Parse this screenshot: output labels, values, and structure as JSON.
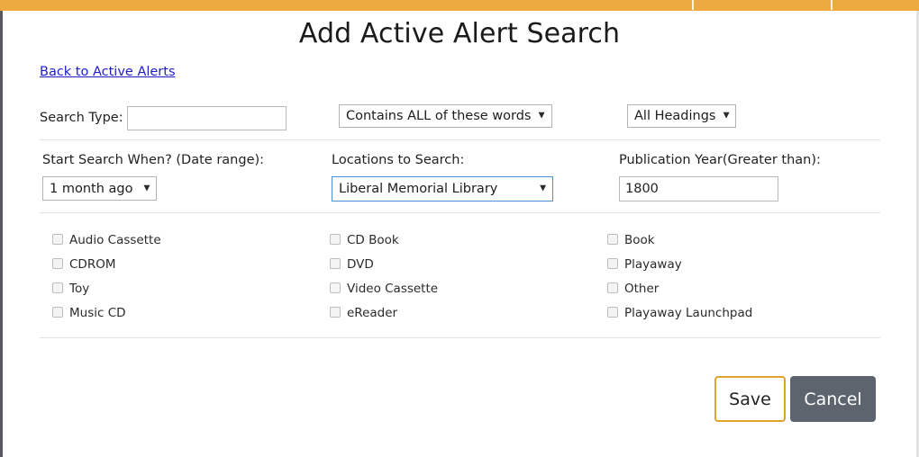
{
  "app": {
    "accent_color": "#eca93e",
    "link_color": "#2020c8",
    "save_border_color": "#e0a42c",
    "cancel_bg_color": "#5d646e"
  },
  "header": {
    "title": "Add Active Alert Search",
    "back_link": "Back to Active Alerts"
  },
  "search_row": {
    "search_type_label": "Search Type:",
    "search_type_value": "",
    "search_type_placeholder": "",
    "match_mode_value": "Contains ALL of these words",
    "headings_value": "All Headings",
    "caret_icon": "▼"
  },
  "criteria_row": {
    "date_label": "Start Search When? (Date range):",
    "date_value": "1 month ago",
    "locations_label": "Locations to Search:",
    "locations_value": "Liberal Memorial Library",
    "pub_year_label": "Publication Year(Greater than):",
    "pub_year_value": "1800"
  },
  "formats": {
    "columns": [
      [
        {
          "label": "Audio Cassette",
          "checked": false
        },
        {
          "label": "CDROM",
          "checked": false
        },
        {
          "label": "Toy",
          "checked": false
        },
        {
          "label": "Music CD",
          "checked": false
        }
      ],
      [
        {
          "label": "CD Book",
          "checked": false
        },
        {
          "label": "DVD",
          "checked": false
        },
        {
          "label": "Video Cassette",
          "checked": false
        },
        {
          "label": "eReader",
          "checked": false
        }
      ],
      [
        {
          "label": "Book",
          "checked": false
        },
        {
          "label": "Playaway",
          "checked": false
        },
        {
          "label": "Other",
          "checked": false
        },
        {
          "label": "Playaway Launchpad",
          "checked": false
        }
      ]
    ]
  },
  "footer": {
    "save_label": "Save",
    "cancel_label": "Cancel"
  }
}
